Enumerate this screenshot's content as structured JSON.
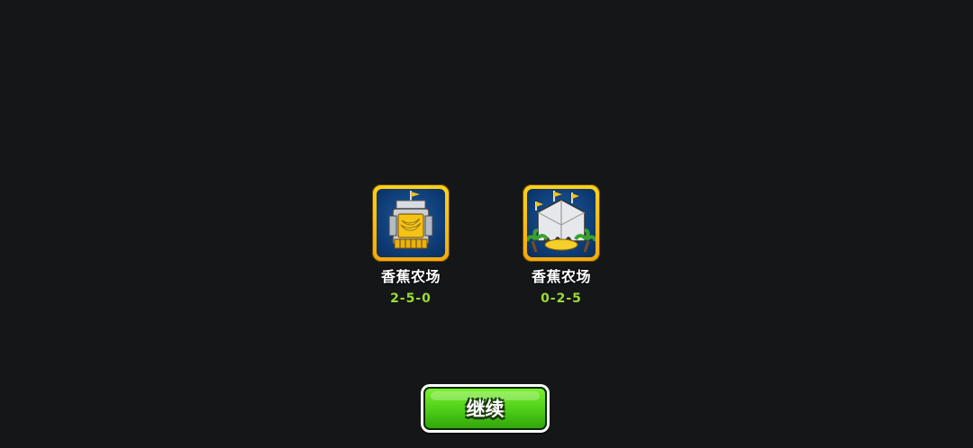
{
  "towers": [
    {
      "name": "香蕉农场",
      "path": "2-5-0",
      "icon": "banana-farm-tier5-middle-icon"
    },
    {
      "name": "香蕉农场",
      "path": "0-2-5",
      "icon": "banana-farm-tier5-bottom-icon"
    }
  ],
  "continue_button": {
    "label": "继续"
  },
  "colors": {
    "background": "#151618",
    "path_text": "#9bdc33",
    "icon_border": "#f3a80c",
    "icon_bg": "#0d3a73",
    "button_green": "#4ccd17"
  }
}
